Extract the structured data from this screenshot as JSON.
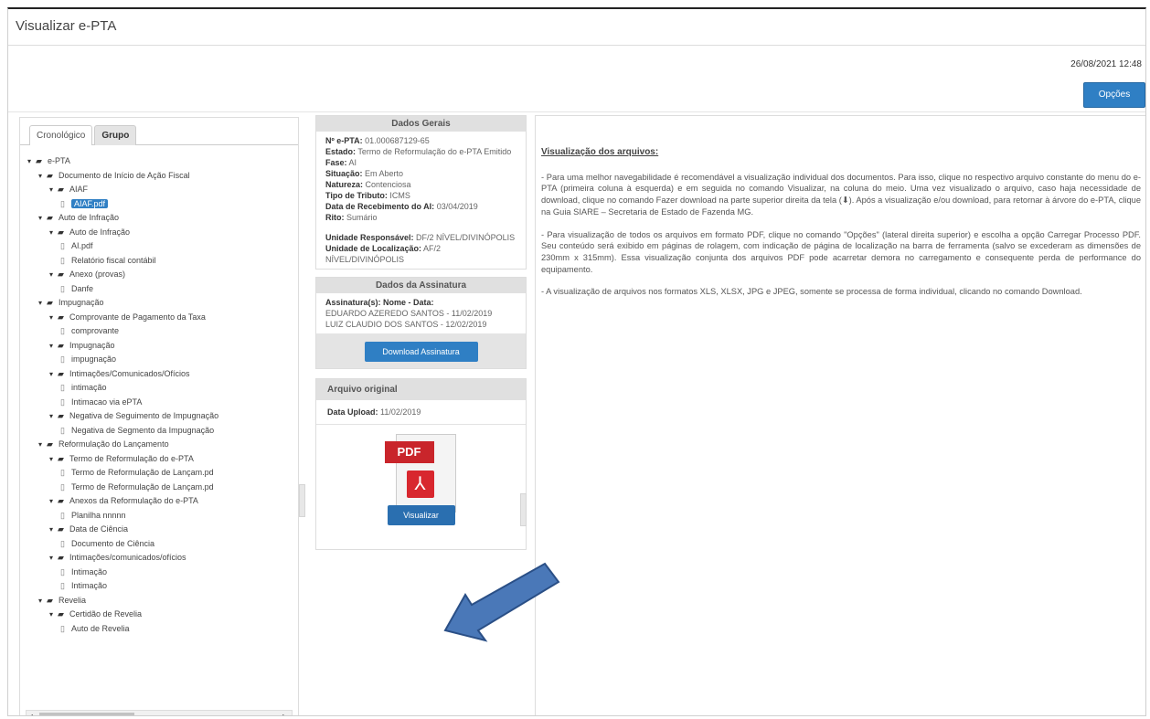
{
  "window": {
    "title": "Visualizar e-PTA",
    "datetime": "26/08/2021 12:48"
  },
  "toolbar": {
    "opcoes_label": "Opções"
  },
  "tabs": [
    {
      "label": "Cronológico",
      "active": false
    },
    {
      "label": "Grupo",
      "active": true
    }
  ],
  "tree": [
    {
      "level": 0,
      "type": "folder",
      "label": "e-PTA"
    },
    {
      "level": 1,
      "type": "folder",
      "label": "Documento de Início de Ação Fiscal"
    },
    {
      "level": 2,
      "type": "folder",
      "label": "AIAF"
    },
    {
      "level": 3,
      "type": "file",
      "label": "AIAF.pdf",
      "selected": true
    },
    {
      "level": 1,
      "type": "folder",
      "label": "Auto de Infração"
    },
    {
      "level": 2,
      "type": "folder",
      "label": "Auto de Infração"
    },
    {
      "level": 3,
      "type": "file",
      "label": "AI.pdf"
    },
    {
      "level": 3,
      "type": "file",
      "label": "Relatório fiscal contábil"
    },
    {
      "level": 2,
      "type": "folder",
      "label": "Anexo (provas)"
    },
    {
      "level": 3,
      "type": "file",
      "label": "Danfe"
    },
    {
      "level": 1,
      "type": "folder",
      "label": "Impugnação"
    },
    {
      "level": 2,
      "type": "folder",
      "label": "Comprovante de Pagamento da Taxa"
    },
    {
      "level": 3,
      "type": "file",
      "label": "comprovante"
    },
    {
      "level": 2,
      "type": "folder",
      "label": "Impugnação"
    },
    {
      "level": 3,
      "type": "file",
      "label": "impugnação"
    },
    {
      "level": 2,
      "type": "folder",
      "label": "Intimações/Comunicados/Ofícios"
    },
    {
      "level": 3,
      "type": "file",
      "label": "intimação"
    },
    {
      "level": 3,
      "type": "file",
      "label": "Intimacao via ePTA"
    },
    {
      "level": 2,
      "type": "folder",
      "label": "Negativa de Seguimento de Impugnação"
    },
    {
      "level": 3,
      "type": "file",
      "label": "Negativa de Segmento da Impugnação"
    },
    {
      "level": 1,
      "type": "folder",
      "label": "Reformulação do Lançamento"
    },
    {
      "level": 2,
      "type": "folder",
      "label": "Termo de Reformulação do e-PTA"
    },
    {
      "level": 3,
      "type": "file",
      "label": "Termo de Reformulação de Lançam.pd"
    },
    {
      "level": 3,
      "type": "file",
      "label": "Termo de Reformulação de Lançam.pd"
    },
    {
      "level": 2,
      "type": "folder",
      "label": "Anexos da Reformulação do e-PTA"
    },
    {
      "level": 3,
      "type": "file",
      "label": "Planilha nnnnn"
    },
    {
      "level": 2,
      "type": "folder",
      "label": "Data de Ciência"
    },
    {
      "level": 3,
      "type": "file",
      "label": "Documento de Ciência"
    },
    {
      "level": 2,
      "type": "folder",
      "label": "Intimações/comunicados/ofícios"
    },
    {
      "level": 3,
      "type": "file",
      "label": "Intimação"
    },
    {
      "level": 3,
      "type": "file",
      "label": "Intimação"
    },
    {
      "level": 1,
      "type": "folder",
      "label": "Revelia"
    },
    {
      "level": 2,
      "type": "folder",
      "label": "Certidão de Revelia"
    },
    {
      "level": 3,
      "type": "file",
      "label": "Auto de Revelia"
    }
  ],
  "dados_gerais": {
    "header": "Dados Gerais",
    "fields": [
      {
        "label": "Nº e-PTA:",
        "value": "01.000687129-65"
      },
      {
        "label": "Estado:",
        "value": "Termo de Reformulação do e-PTA Emitido"
      },
      {
        "label": "Fase:",
        "value": "AI"
      },
      {
        "label": "Situação:",
        "value": "Em Aberto"
      },
      {
        "label": "Natureza:",
        "value": "Contenciosa"
      },
      {
        "label": "Tipo de Tributo:",
        "value": "ICMS"
      },
      {
        "label": "Data de Recebimento do AI:",
        "value": "03/04/2019"
      },
      {
        "label": "Rito:",
        "value": "Sumário"
      }
    ],
    "fields2": [
      {
        "label": "Unidade Responsável:",
        "value": "DF/2 NÍVEL/DIVINÓPOLIS"
      },
      {
        "label": "Unidade de Localização:",
        "value": "AF/2 NÍVEL/DIVINÓPOLIS"
      }
    ]
  },
  "dados_assinatura": {
    "header": "Dados da Assinatura",
    "label": "Assinatura(s): Nome - Data:",
    "lines": [
      "EDUARDO AZEREDO SANTOS - 11/02/2019",
      "LUIZ CLAUDIO DOS SANTOS - 12/02/2019"
    ],
    "button": "Download Assinatura"
  },
  "arquivo_original": {
    "header": "Arquivo original",
    "upload_label": "Data Upload:",
    "upload_value": "11/02/2019",
    "pdf_tag": "PDF",
    "button": "Visualizar"
  },
  "right": {
    "heading": "Visualização dos arquivos:",
    "p1": "- Para uma melhor navegabilidade é recomendável a visualização individual dos documentos. Para isso, clique no respectivo arquivo constante do menu do e-PTA (primeira coluna à esquerda) e em seguida no comando Visualizar, na coluna do meio. Uma vez visualizado o arquivo, caso haja necessidade de download, clique no comando Fazer download na parte superior direita da tela (⬇). Após a visualização e/ou download, para retornar à árvore do e-PTA, clique na Guia SIARE – Secretaria de Estado de Fazenda MG.",
    "p2": "- Para visualização de todos os arquivos em formato PDF, clique no comando \"Opções\" (lateral direita superior) e escolha a opção Carregar Processo PDF. Seu conteúdo será exibido em páginas de rolagem, com indicação de página de localização na barra de ferramenta (salvo se excederam as dimensões de 230mm x 315mm). Essa visualização conjunta dos arquivos PDF pode acarretar demora no carregamento e consequente perda de performance do equipamento.",
    "p3": "- A visualização de arquivos nos formatos XLS, XLSX, JPG e JPEG, somente se processa de forma individual, clicando no comando Download."
  },
  "colors": {
    "accent": "#2f7fc4",
    "pdf_red": "#c9252b",
    "annotation_arrow": "#4a78b8"
  }
}
